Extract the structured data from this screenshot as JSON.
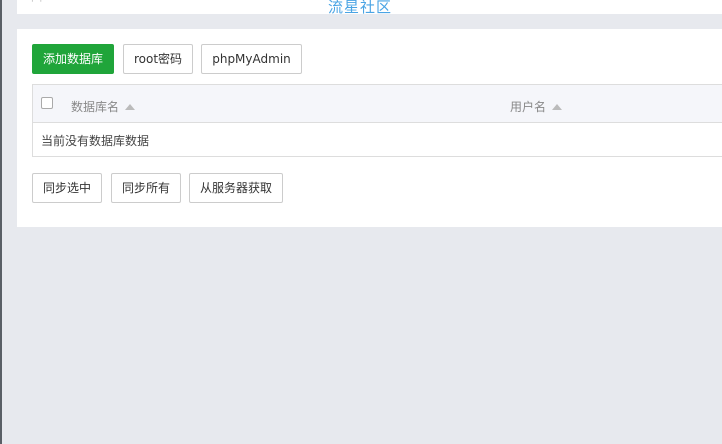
{
  "watermark": "流星社区",
  "toolbar": {
    "add_database": "添加数据库",
    "root_password": "root密码",
    "phpmyadmin": "phpMyAdmin"
  },
  "table": {
    "columns": [
      "数据库名",
      "用户名"
    ],
    "empty_text": "当前没有数据库数据"
  },
  "footer_actions": {
    "sync_selected": "同步选中",
    "sync_all": "同步所有",
    "fetch_from_server": "从服务器获取"
  },
  "colors": {
    "accent_green": "#20a53a",
    "watermark_blue": "#4aa4e4",
    "page_background": "#e7e9ee"
  }
}
